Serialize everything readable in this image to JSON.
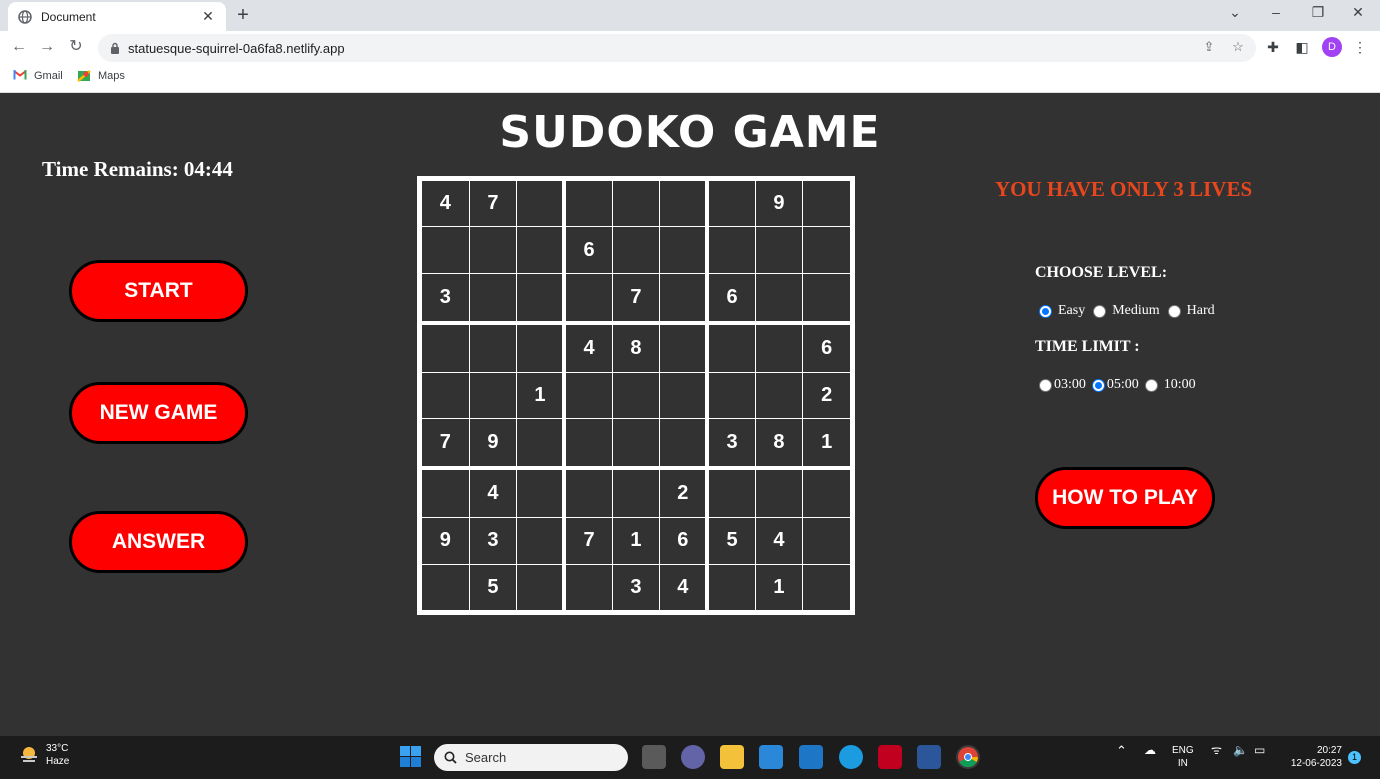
{
  "browser": {
    "tab_title": "Document",
    "url": "statuesque-squirrel-0a6fa8.netlify.app",
    "bookmarks": [
      "Gmail",
      "Maps"
    ],
    "profile_initial": "D"
  },
  "page": {
    "title": "SUDOKO GAME",
    "timer": "Time Remains: 04:44",
    "buttons": {
      "start": "START",
      "new_game": "NEW GAME",
      "answer": "ANSWER",
      "how_to_play": "HOW TO PLAY"
    },
    "lives": "YOU HAVE ONLY 3 LIVES",
    "level": {
      "heading": "CHOOSE LEVEL:",
      "options": [
        "Easy",
        "Medium",
        "Hard"
      ],
      "selected": "Easy"
    },
    "time_limit": {
      "heading": "TIME LIMIT :",
      "options": [
        "03:00",
        "05:00",
        "10:00"
      ],
      "selected": "05:00"
    },
    "grid": [
      [
        "4",
        "7",
        "",
        "",
        "",
        "",
        "",
        "9",
        ""
      ],
      [
        "",
        "",
        "",
        "6",
        "",
        "",
        "",
        "",
        ""
      ],
      [
        "3",
        "",
        "",
        "",
        "7",
        "",
        "6",
        "",
        ""
      ],
      [
        "",
        "",
        "",
        "4",
        "8",
        "",
        "",
        "",
        "6"
      ],
      [
        "",
        "",
        "1",
        "",
        "",
        "",
        "",
        "",
        "2"
      ],
      [
        "7",
        "9",
        "",
        "",
        "",
        "",
        "3",
        "8",
        "1"
      ],
      [
        "",
        "4",
        "",
        "",
        "",
        "2",
        "",
        "",
        ""
      ],
      [
        "9",
        "3",
        "",
        "7",
        "1",
        "6",
        "5",
        "4",
        ""
      ],
      [
        "",
        "5",
        "",
        "",
        "3",
        "4",
        "",
        "1",
        ""
      ]
    ]
  },
  "taskbar": {
    "weather_temp": "33°C",
    "weather_desc": "Haze",
    "search_placeholder": "Search",
    "lang_line1": "ENG",
    "lang_line2": "IN",
    "time": "20:27",
    "date": "12-06-2023",
    "notification_count": "1"
  }
}
